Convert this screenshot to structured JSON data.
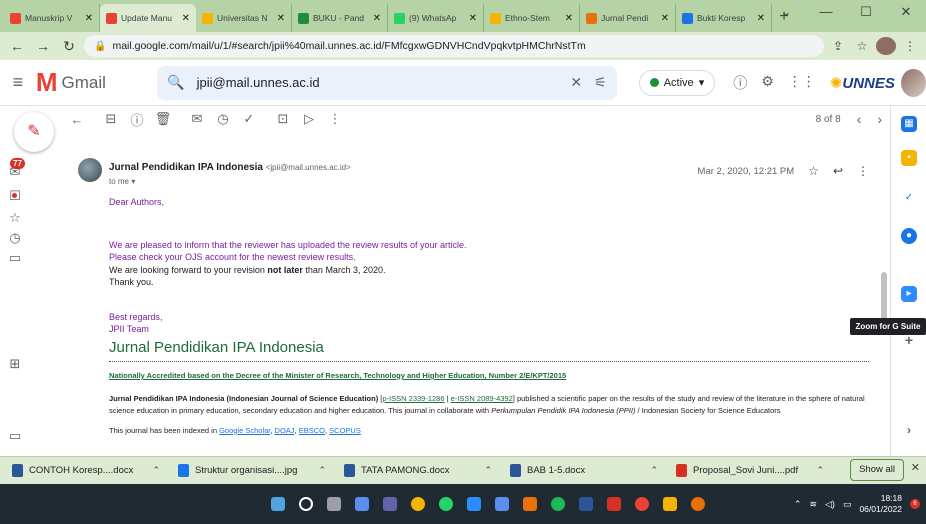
{
  "browser": {
    "tabs": [
      {
        "label": "Manuskrip V",
        "favicon": "gmail-icon",
        "color": "#ea4335"
      },
      {
        "label": "Update Manu",
        "favicon": "gmail-icon",
        "color": "#ea4335",
        "active": true
      },
      {
        "label": "Universitas N",
        "favicon": "doc-icon",
        "color": "#f4b400"
      },
      {
        "label": "BUKU - Pand",
        "favicon": "drive-icon",
        "color": "#1e8e3e"
      },
      {
        "label": "(9) WhatsAp",
        "favicon": "whatsapp-icon",
        "color": "#25d366"
      },
      {
        "label": "Ethno-Stem",
        "favicon": "doc-icon",
        "color": "#f4b400"
      },
      {
        "label": "Jurnal Pendi",
        "favicon": "journal-icon",
        "color": "#e8710a"
      },
      {
        "label": "Bukti Koresp",
        "favicon": "docs-icon",
        "color": "#1a73e8"
      }
    ],
    "new_tab": "+",
    "url": "mail.google.com/mail/u/1/#search/jpii%40mail.unnes.ac.id/FMfcgxwGDNVHCndVpqkvtpHMChrNstTm"
  },
  "gmail": {
    "brand": "Gmail",
    "search_query": "jpii@mail.unnes.ac.id",
    "status": "Active",
    "org_logo": "UNNES",
    "inbox_badge": "77",
    "pager": "8 of 8"
  },
  "message": {
    "sender_name": "Jurnal Pendidikan IPA Indonesia",
    "sender_email": "<jpii@mail.unnes.ac.id>",
    "to": "to me",
    "date": "Mar 2, 2020, 12:21 PM",
    "greeting": "Dear Authors,",
    "line1": "We are pleased to inform that the reviewer has uploaded the review results of your article.",
    "line2": "Please check your OJS account for the newest review results.",
    "line3_pre": "We are looking forward to your revision ",
    "line3_bold": "not later",
    "line3_post": " than March 3, 2020.",
    "line4": "Thank you.",
    "regards": "Best regards,",
    "team": "JPII Team",
    "journal_title": "Jurnal Pendidikan IPA Indonesia",
    "accreditation": "Nationally Accredited based on the Decree of the Minister of Research, Technology and Higher Education, Number 2/E/KPT/2015",
    "desc_bold": "Jurnal Pendidikan IPA Indonesia (Indonesian Journal of Science Education)",
    "pissn": "p-ISSN 2339-1286",
    "eissn": "e-ISSN 2089-4392",
    "desc_mid": " published a scientific paper on the results of the study and review of the literature in the sphere of natural science education in primary education, secondary education and higher education. This journal in collaborate with ",
    "ppii": "Perkumpulan Pendidik IPA Indonesia (PPII)",
    "desc_end": " / Indonesian Society for Science Educators",
    "indexed_pre": "This journal has been indexed in ",
    "idx1": "Google Scholar",
    "idx2": "DOAJ",
    "idx3": "EBSCO",
    "idx4": "SCOPUS"
  },
  "side": {
    "zoom_tooltip": "Zoom for G Suite"
  },
  "downloads": [
    {
      "label": "CONTOH Koresp....docx",
      "icon": "word-icon",
      "color": "#2b579a"
    },
    {
      "label": "Struktur organisasi....jpg",
      "icon": "image-icon",
      "color": "#1a73e8"
    },
    {
      "label": "TATA PAMONG.docx",
      "icon": "word-icon",
      "color": "#2b579a"
    },
    {
      "label": "BAB 1-5.docx",
      "icon": "word-icon",
      "color": "#2b579a"
    },
    {
      "label": "Proposal_Sovi Juni....pdf",
      "icon": "pdf-icon",
      "color": "#d93025"
    }
  ],
  "shelf": {
    "show_all": "Show all"
  },
  "taskbar": {
    "time": "18:18",
    "date": "06/01/2022",
    "notifications": "6"
  }
}
